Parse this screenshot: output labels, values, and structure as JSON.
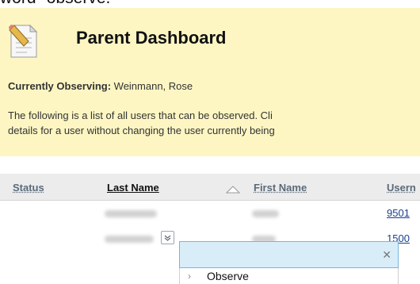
{
  "caption": "word \"observe.\"",
  "header": {
    "title": "Parent Dashboard",
    "icon": "document-pencil-icon"
  },
  "observing": {
    "label": "Currently Observing:",
    "value": "Weinmann, Rose"
  },
  "description": {
    "line1": "The following is a list of all users that can be observed. Cli",
    "line2": "details for a user without changing the user currently being"
  },
  "table": {
    "columns": [
      "Status",
      "Last Name",
      "First Name",
      "Usern"
    ],
    "sort_column": "Last Name",
    "sort_direction": "ascending",
    "rows": [
      {
        "username": "9501"
      },
      {
        "username": "1500"
      }
    ]
  },
  "context_menu": {
    "items": [
      "Observe"
    ]
  },
  "colors": {
    "banner": "#fdf6c3",
    "link": "#1a3f8c",
    "menu_header": "#d9edf9"
  }
}
